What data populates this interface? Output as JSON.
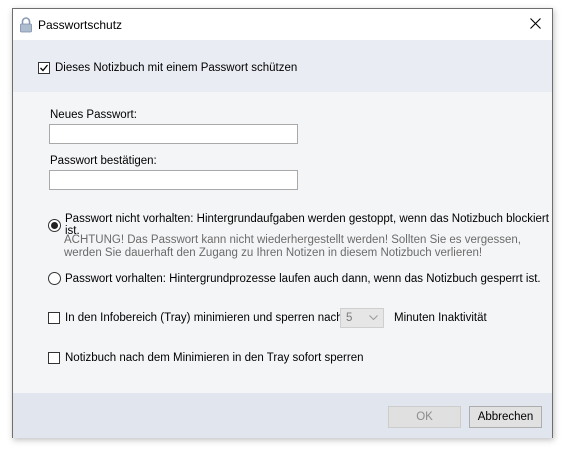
{
  "window": {
    "title": "Passwortschutz",
    "icon": "lock-icon",
    "close_icon": "close-icon"
  },
  "protect_checkbox": {
    "label": "Dieses Notizbuch mit einem Passwort schützen",
    "checked": true
  },
  "new_password": {
    "label": "Neues Passwort:",
    "value": ""
  },
  "confirm_password": {
    "label": "Passwort bestätigen:",
    "value": ""
  },
  "radio_no_keep": {
    "label": "Passwort nicht vorhalten: Hintergrundaufgaben werden gestoppt, wenn das Notizbuch blockiert ist.",
    "selected": true,
    "warning_line1": "ACHTUNG! Das Passwort kann nicht wiederhergestellt werden! Sollten Sie es vergessen,",
    "warning_line2": "werden Sie dauerhaft den Zugang zu Ihren Notizen in diesem Notizbuch verlieren!"
  },
  "radio_keep": {
    "label": "Passwort vorhalten: Hintergrundprozesse laufen auch dann, wenn das Notizbuch gesperrt ist.",
    "selected": false
  },
  "tray_checkbox": {
    "label": "In den Infobereich (Tray) minimieren und sperren nach",
    "checked": false,
    "minutes_value": "5",
    "minutes_suffix": "Minuten Inaktivität"
  },
  "lock_checkbox": {
    "label": "Notizbuch nach dem Minimieren in den Tray sofort sperren",
    "checked": false
  },
  "buttons": {
    "ok": "OK",
    "cancel": "Abbrechen"
  },
  "colors": {
    "top_band": "#e9edf3",
    "body": "#f4f5f7",
    "bottom_band": "#e1e6ee",
    "warning_text": "#6b6b6b"
  }
}
